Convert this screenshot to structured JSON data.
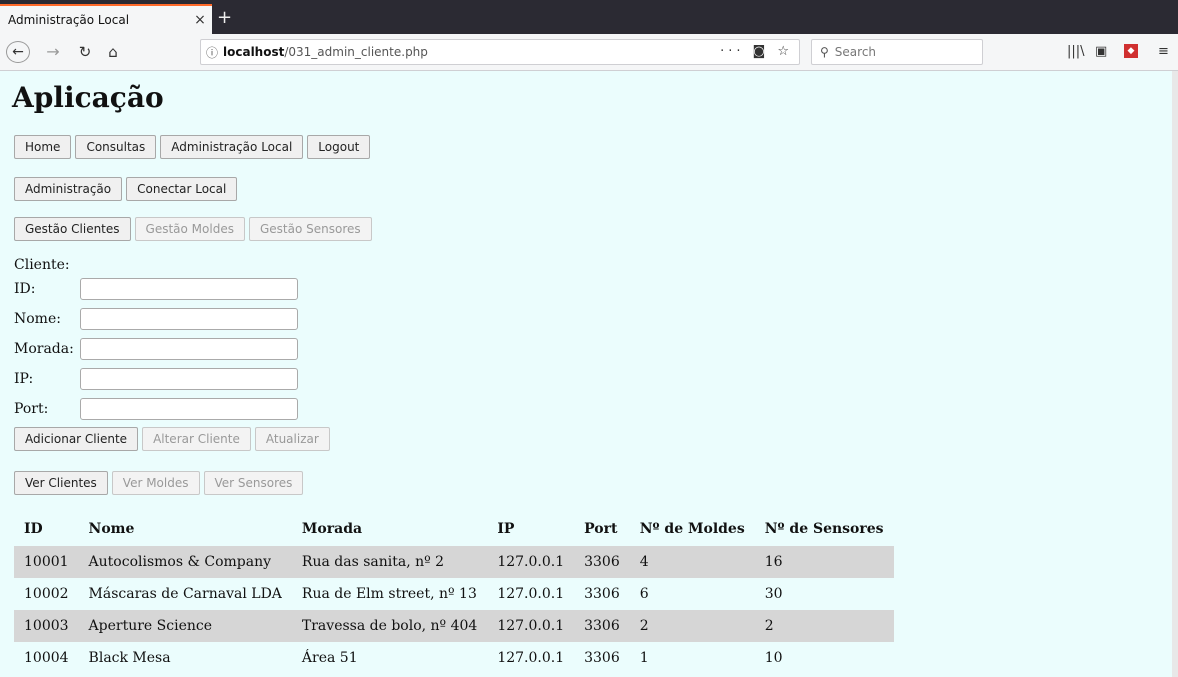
{
  "browser": {
    "tab_title": "Administração Local",
    "tab_close": "×",
    "new_tab": "+",
    "url_host": "localhost",
    "url_path": "/031_admin_cliente.php",
    "search_placeholder": "Search"
  },
  "page": {
    "title": "Aplicação",
    "nav_main": [
      "Home",
      "Consultas",
      "Administração Local",
      "Logout"
    ],
    "nav_admin": [
      "Administração",
      "Conectar Local"
    ],
    "nav_gestao": [
      "Gestão Clientes",
      "Gestão Moldes",
      "Gestão Sensores"
    ],
    "form": {
      "heading": "Cliente:",
      "fields": [
        "ID:",
        "Nome:",
        "Morada:",
        "IP:",
        "Port:"
      ],
      "actions": [
        "Adicionar Cliente",
        "Alterar Cliente",
        "Atualizar"
      ]
    },
    "view_buttons": [
      "Ver Clientes",
      "Ver Moldes",
      "Ver Sensores"
    ],
    "table": {
      "headers": [
        "ID",
        "Nome",
        "Morada",
        "IP",
        "Port",
        "Nº de Moldes",
        "Nº de Sensores"
      ],
      "rows": [
        [
          "10001",
          "Autocolismos & Company",
          "Rua das sanita, nº 2",
          "127.0.0.1",
          "3306",
          "4",
          "16"
        ],
        [
          "10002",
          "Máscaras de Carnaval LDA",
          "Rua de Elm street, nº 13",
          "127.0.0.1",
          "3306",
          "6",
          "30"
        ],
        [
          "10003",
          "Aperture Science",
          "Travessa de bolo, nº 404",
          "127.0.0.1",
          "3306",
          "2",
          "2"
        ],
        [
          "10004",
          "Black Mesa",
          "Área 51",
          "127.0.0.1",
          "3306",
          "1",
          "10"
        ]
      ]
    }
  }
}
